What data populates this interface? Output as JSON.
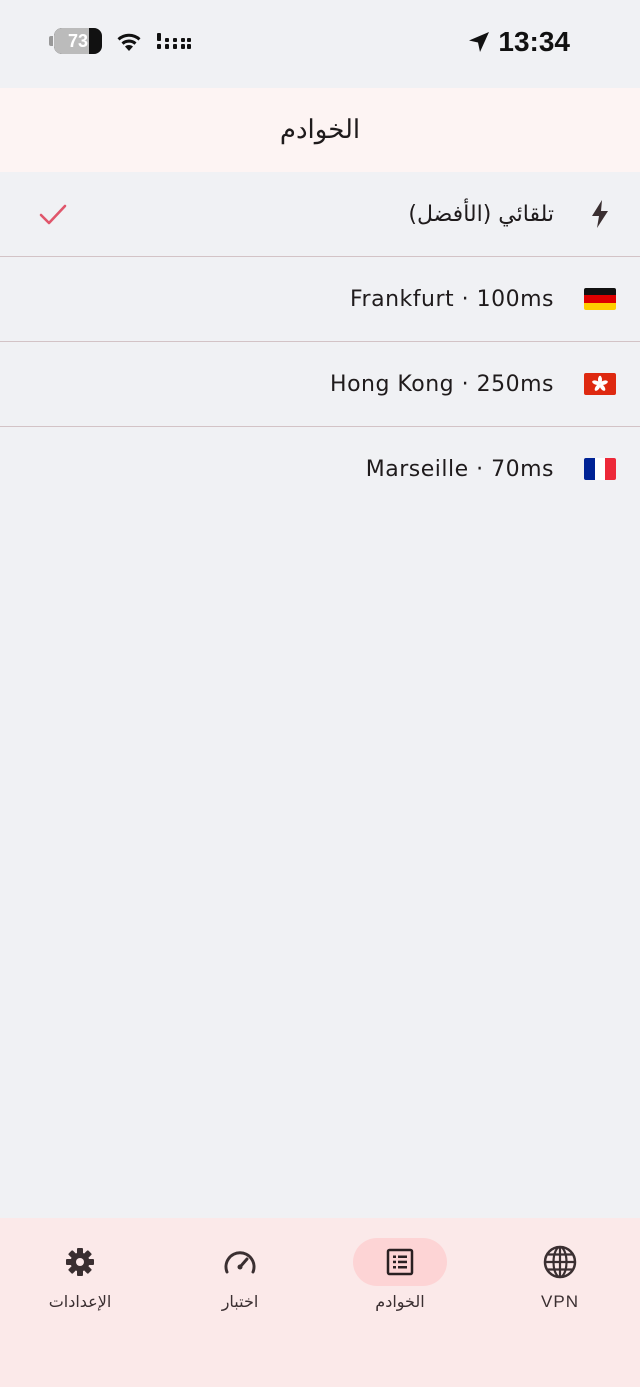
{
  "status_bar": {
    "battery": "73",
    "battery_level": 0.73,
    "time": "13:34"
  },
  "app_bar": {
    "title": "الخوادم"
  },
  "servers": [
    {
      "label": "تلقائي (الأفضل)",
      "icon": "lightning-bolt-icon",
      "selected": true
    },
    {
      "label": "Frankfurt · 100ms",
      "icon": "germany-flag-icon",
      "selected": false
    },
    {
      "label": "Hong Kong · 250ms",
      "icon": "hong-kong-flag-icon",
      "selected": false
    },
    {
      "label": "Marseille · 70ms",
      "icon": "france-flag-icon",
      "selected": false
    }
  ],
  "nav": [
    {
      "label": "الإعدادات",
      "icon": "gear-icon",
      "active": false
    },
    {
      "label": "اختبار",
      "icon": "speedometer-icon",
      "active": false
    },
    {
      "label": "الخوادم",
      "icon": "server-list-icon",
      "active": true
    },
    {
      "label": "VPN",
      "icon": "globe-icon",
      "active": false
    }
  ],
  "colors": {
    "accent": "#e0566b",
    "active_pill": "#fdd4d5",
    "nav_bg": "#fbe9e9",
    "app_bar_bg": "#fdf4f3",
    "page_bg": "#f0f1f4"
  }
}
